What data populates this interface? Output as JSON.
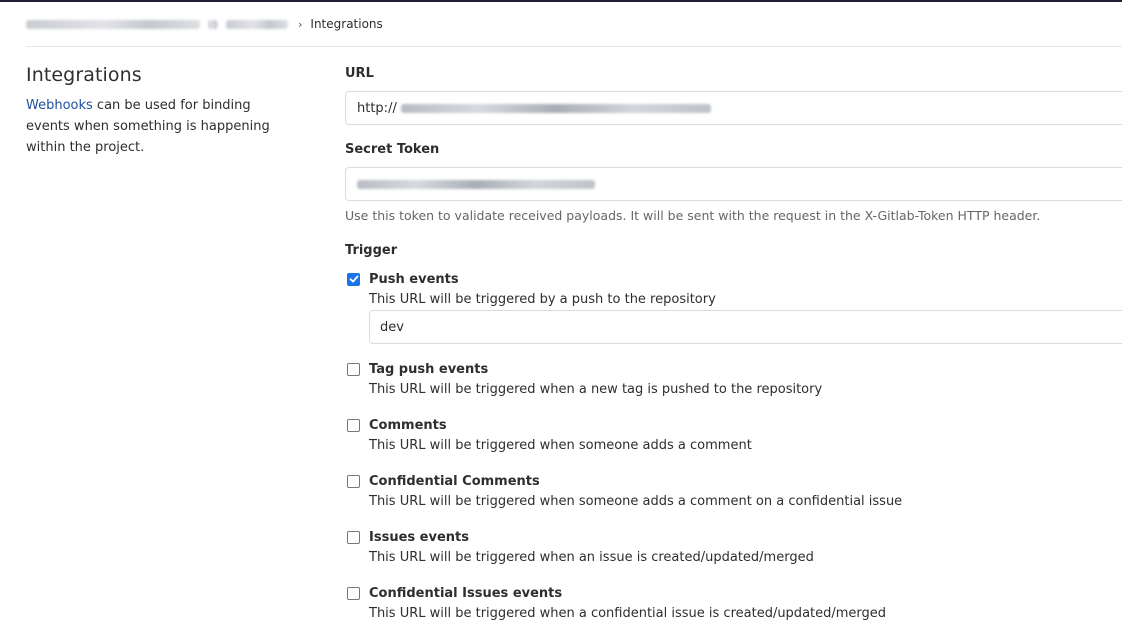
{
  "breadcrumb": {
    "current": "Integrations"
  },
  "sidebar": {
    "title": "Integrations",
    "link_text": "Webhooks",
    "description": " can be used for binding events when something is happening within the project."
  },
  "url_field": {
    "label": "URL",
    "value_prefix": "http://"
  },
  "secret_token": {
    "label": "Secret Token",
    "help": "Use this token to validate received payloads. It will be sent with the request in the X-Gitlab-Token HTTP header."
  },
  "trigger": {
    "label": "Trigger",
    "push_branch_value": "dev",
    "items": [
      {
        "title": "Push events",
        "description": "This URL will be triggered by a push to the repository",
        "checked": true
      },
      {
        "title": "Tag push events",
        "description": "This URL will be triggered when a new tag is pushed to the repository",
        "checked": false
      },
      {
        "title": "Comments",
        "description": "This URL will be triggered when someone adds a comment",
        "checked": false
      },
      {
        "title": "Confidential Comments",
        "description": "This URL will be triggered when someone adds a comment on a confidential issue",
        "checked": false
      },
      {
        "title": "Issues events",
        "description": "This URL will be triggered when an issue is created/updated/merged",
        "checked": false
      },
      {
        "title": "Confidential Issues events",
        "description": "This URL will be triggered when a confidential issue is created/updated/merged",
        "checked": false
      }
    ]
  },
  "icons": {
    "chevron": "chevron-right-icon",
    "checkmark": "checkmark-icon"
  },
  "colors": {
    "link": "#1f4f9c",
    "checkbox_checked": "#1a73e8"
  }
}
